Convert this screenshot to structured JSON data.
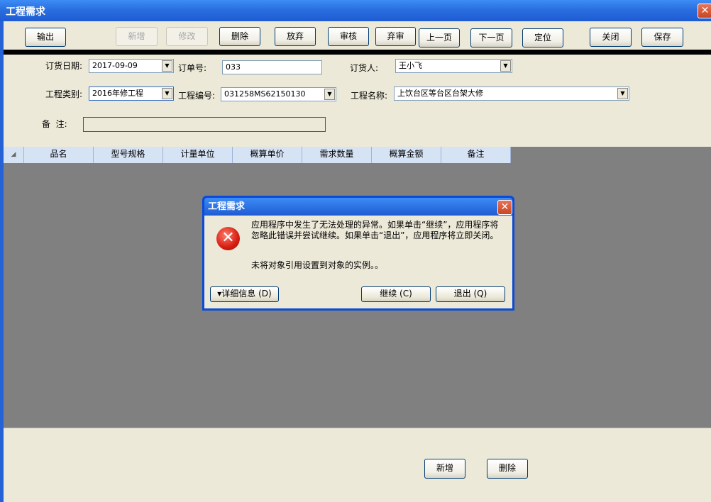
{
  "window": {
    "title": "工程需求",
    "close": "✕"
  },
  "toolbar": {
    "output": "输出",
    "new": "新增",
    "modify": "修改",
    "delete": "删除",
    "abandon": "放弃",
    "audit": "审核",
    "abandon_audit": "弃审",
    "prev_page": "上一页",
    "next_page": "下一页",
    "locate": "定位",
    "close": "关闭",
    "save": "保存"
  },
  "form": {
    "order_date_label": "订货日期:",
    "order_date": "2017-09-09",
    "order_no_label": "订单号:",
    "order_no": "033",
    "orderer_label": "订货人:",
    "orderer": "王小飞",
    "project_type_label": "工程类别:",
    "project_type": "2016年修工程",
    "project_no_label": "工程编号:",
    "project_no": "031258MS62150130",
    "project_name_label": "工程名称:",
    "project_name": "上饮台区等台区台架大修",
    "remark_label": "备  注:",
    "remark": ""
  },
  "grid": {
    "corner": "◢",
    "columns": [
      "品名",
      "型号规格",
      "计量单位",
      "概算单价",
      "需求数量",
      "概算金额",
      "备注"
    ]
  },
  "bottom": {
    "new": "新增",
    "delete": "删除"
  },
  "dialog": {
    "title": "工程需求",
    "close": "✕",
    "icon": "✕",
    "message": "应用程序中发生了无法处理的异常。如果单击“继续”，应用程序将忽略此错误并尝试继续。如果单击“退出”，应用程序将立即关闭。",
    "detail_message": "未将对象引用设置到对象的实例。。",
    "details_button": "▾详细信息 (D)",
    "continue_button": "继续 (C)",
    "quit_button": "退出 (Q)"
  },
  "colors": {
    "titlebar": "#2a6fe0",
    "error_icon": "#d41e11",
    "grid_bg": "#808080"
  }
}
